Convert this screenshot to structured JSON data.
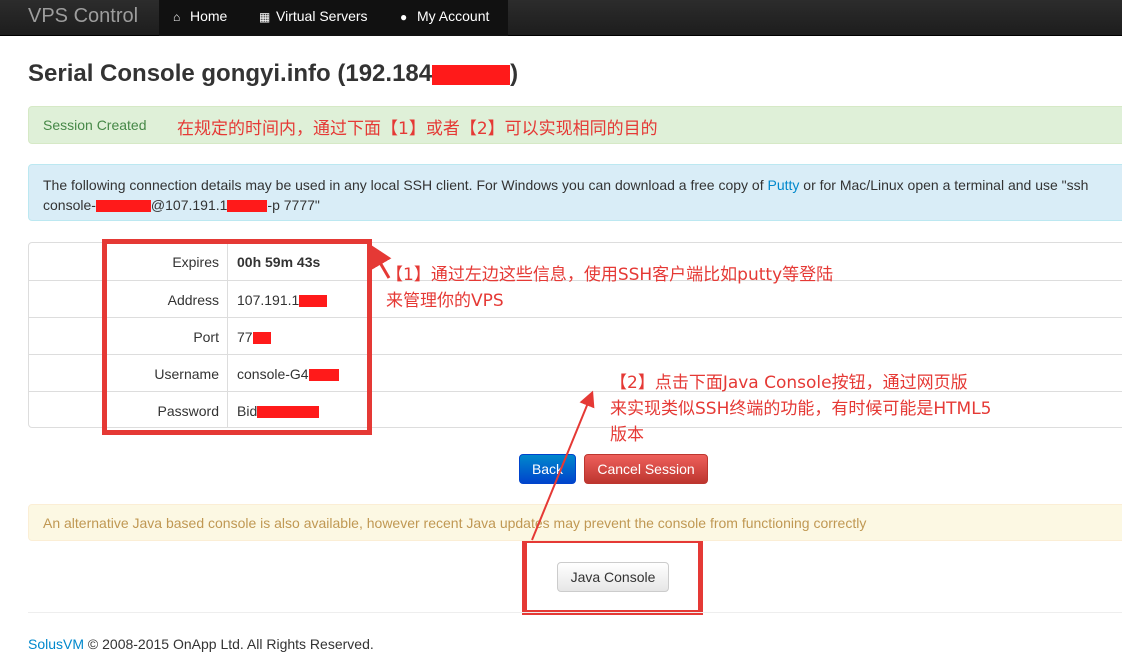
{
  "navbar": {
    "brand": "VPS Control",
    "items": [
      {
        "label": "Home",
        "icon": "home-icon"
      },
      {
        "label": "Virtual Servers",
        "icon": "grid-icon"
      },
      {
        "label": "My Account",
        "icon": "user-icon"
      }
    ]
  },
  "page": {
    "title_prefix": "Serial Console gongyi.info (192.184",
    "title_suffix": ")"
  },
  "alerts": {
    "success": "Session Created",
    "info_line1_pre": "The following connection details may be used in any local SSH client. For Windows you can download a free copy of ",
    "info_link": "Putty",
    "info_line1_post": " or for Mac/Linux open a terminal and use \"ssh",
    "info_line2_a": "console-",
    "info_line2_b": "@107.191.1",
    "info_line2_c": "-p 7777\"",
    "warning": "An alternative Java based console is also available, however recent Java updates may prevent the console from functioning correctly"
  },
  "details": {
    "rows": [
      {
        "label": "Expires",
        "value": "00h 59m 43s"
      },
      {
        "label": "Address",
        "value": "107.191.1"
      },
      {
        "label": "Port",
        "value": "77"
      },
      {
        "label": "Username",
        "value": "console-G4"
      },
      {
        "label": "Password",
        "value": "Bid"
      }
    ]
  },
  "buttons": {
    "back": "Back",
    "cancel": "Cancel Session",
    "java": "Java Console"
  },
  "annotations": {
    "top": "在规定的时间内，通过下面【1】或者【2】可以实现相同的目的",
    "one_line1": "【1】通过左边这些信息，使用SSH客户端比如putty等登陆",
    "one_line2": "来管理你的VPS",
    "two_line1": "【2】点击下面Java Console按钮，通过网页版",
    "two_line2": "来实现类似SSH终端的功能，有时候可能是HTML5",
    "two_line3": "版本"
  },
  "footer": {
    "brand_link": "SolusVM",
    "copyright": " © 2008-2015 OnApp Ltd. All Rights Reserved."
  },
  "colors": {
    "annotation_red": "#e53935",
    "redaction": "#ff1a1a",
    "link": "#0088cc"
  }
}
